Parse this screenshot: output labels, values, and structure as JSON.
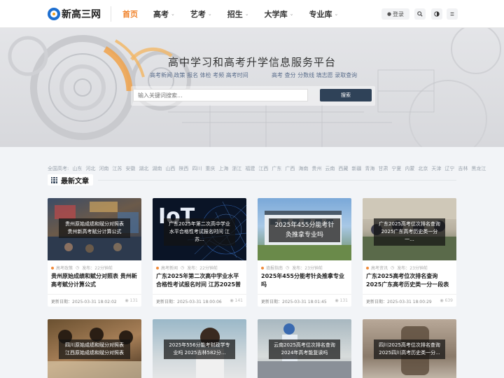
{
  "header": {
    "logo_text": "新高三网",
    "nav": [
      {
        "label": "首页",
        "active": true,
        "dropdown": false
      },
      {
        "label": "高考",
        "active": false,
        "dropdown": true
      },
      {
        "label": "艺考",
        "active": false,
        "dropdown": true
      },
      {
        "label": "招生",
        "active": false,
        "dropdown": true
      },
      {
        "label": "大学库",
        "active": false,
        "dropdown": true
      },
      {
        "label": "专业库",
        "active": false,
        "dropdown": true
      }
    ],
    "login_label": "登录",
    "icons": [
      "search-icon",
      "theme-toggle-icon",
      "menu-icon"
    ]
  },
  "banner": {
    "title": "高中学习和高考升学信息服务平台",
    "links_left": "高考新闻 政策 报名 体检 考频 高考时间",
    "links_right": "高考 查分 分数线 填志愿 录取查询",
    "search_placeholder": "输入关键词搜索...",
    "search_button": "搜索"
  },
  "regions": [
    "全国高考:",
    "山东",
    "河北",
    "河南",
    "江苏",
    "安徽",
    "湖北",
    "湖南",
    "山西",
    "陕西",
    "四川",
    "重庆",
    "上海",
    "浙江",
    "福建",
    "江西",
    "广东",
    "广西",
    "海南",
    "贵州",
    "云南",
    "西藏",
    "新疆",
    "青海",
    "甘肃",
    "宁夏",
    "内蒙",
    "北京",
    "天津",
    "辽宁",
    "吉林",
    "黑龙江"
  ],
  "section": {
    "title": "最新文章"
  },
  "cards": [
    {
      "caption": "贵州原始成绩和赋分对照表 贵州新高考赋分计算公式",
      "category": "高考政策",
      "published": "发布：22分钟前",
      "title": "贵州原始成绩和赋分对照表 贵州新高考赋分计算公式",
      "updated": "更新日期：2025-03-31 18:02:02",
      "views": "131"
    },
    {
      "caption": "广东2025年第二次高中学业水平合格性考试报名时间 江苏...",
      "category": "高考新闻",
      "published": "发布：22分钟前",
      "title": "广东2025年第二次高中学业水平合格性考试报名时间 江苏2025普通高中...",
      "updated": "更新日期：2025-03-31 18:00:06",
      "views": "141"
    },
    {
      "caption": "2025年455分能考针灸推拿专业吗",
      "category": "填报指南",
      "published": "发布：23分钟前",
      "title": "2025年455分能考针灸推拿专业吗",
      "updated": "更新日期：2025-03-31 18:01:45",
      "views": "131"
    },
    {
      "caption": "广东2025高考位次排名查询 2025广东高考历史类一分一...",
      "category": "高考资讯",
      "published": "发布：23分钟前",
      "title": "广东2025高考位次排名查询 2025广东高考历史类一分一段表",
      "updated": "更新日期：2025-03-31 18:00:29",
      "views": "639"
    }
  ],
  "cards_row2": [
    {
      "caption": "四川原始成绩和赋分对照表 江西原始成绩和赋分对照表"
    },
    {
      "caption": "2025年556分能考财政学专业吗 2025吉林582分..."
    },
    {
      "caption": "云南2025高考位次排名查询 2024年高考能复读吗"
    },
    {
      "caption": "四川2025高考位次排名查询 2025四川高考历史类一分..."
    }
  ],
  "colors": {
    "accent": "#f0822a",
    "search_button": "#2f4258",
    "brand": "#1e6fd0"
  }
}
